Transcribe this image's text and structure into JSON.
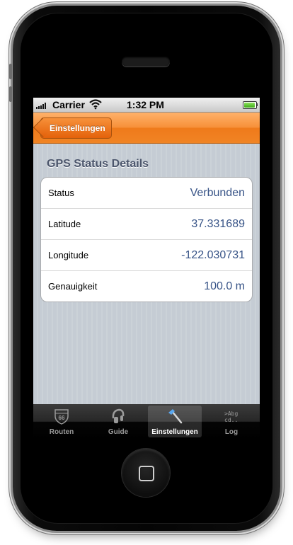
{
  "status_bar": {
    "carrier": "Carrier",
    "time": "1:32 PM",
    "battery_level": 0.95
  },
  "nav_bar": {
    "back_label": "Einstellungen",
    "color": "#f08424"
  },
  "section": {
    "header": "GPS Status Details",
    "rows": [
      {
        "label": "Status",
        "value": "Verbunden"
      },
      {
        "label": "Latitude",
        "value": "37.331689"
      },
      {
        "label": "Longitude",
        "value": "-122.030731"
      },
      {
        "label": "Genauigkeit",
        "value": "100.0 m"
      }
    ],
    "value_color": "#385487"
  },
  "tab_bar": {
    "tabs": [
      {
        "label": "Routen",
        "icon": "route-66-shield-icon",
        "icon_text": "ROUTE 66"
      },
      {
        "label": "Guide",
        "icon": "headphones-icon"
      },
      {
        "label": "Einstellungen",
        "icon": "hammer-icon",
        "selected": true
      },
      {
        "label": "Log",
        "icon": "text-log-icon",
        "icon_text": ">Abg\ncd.."
      }
    ]
  }
}
